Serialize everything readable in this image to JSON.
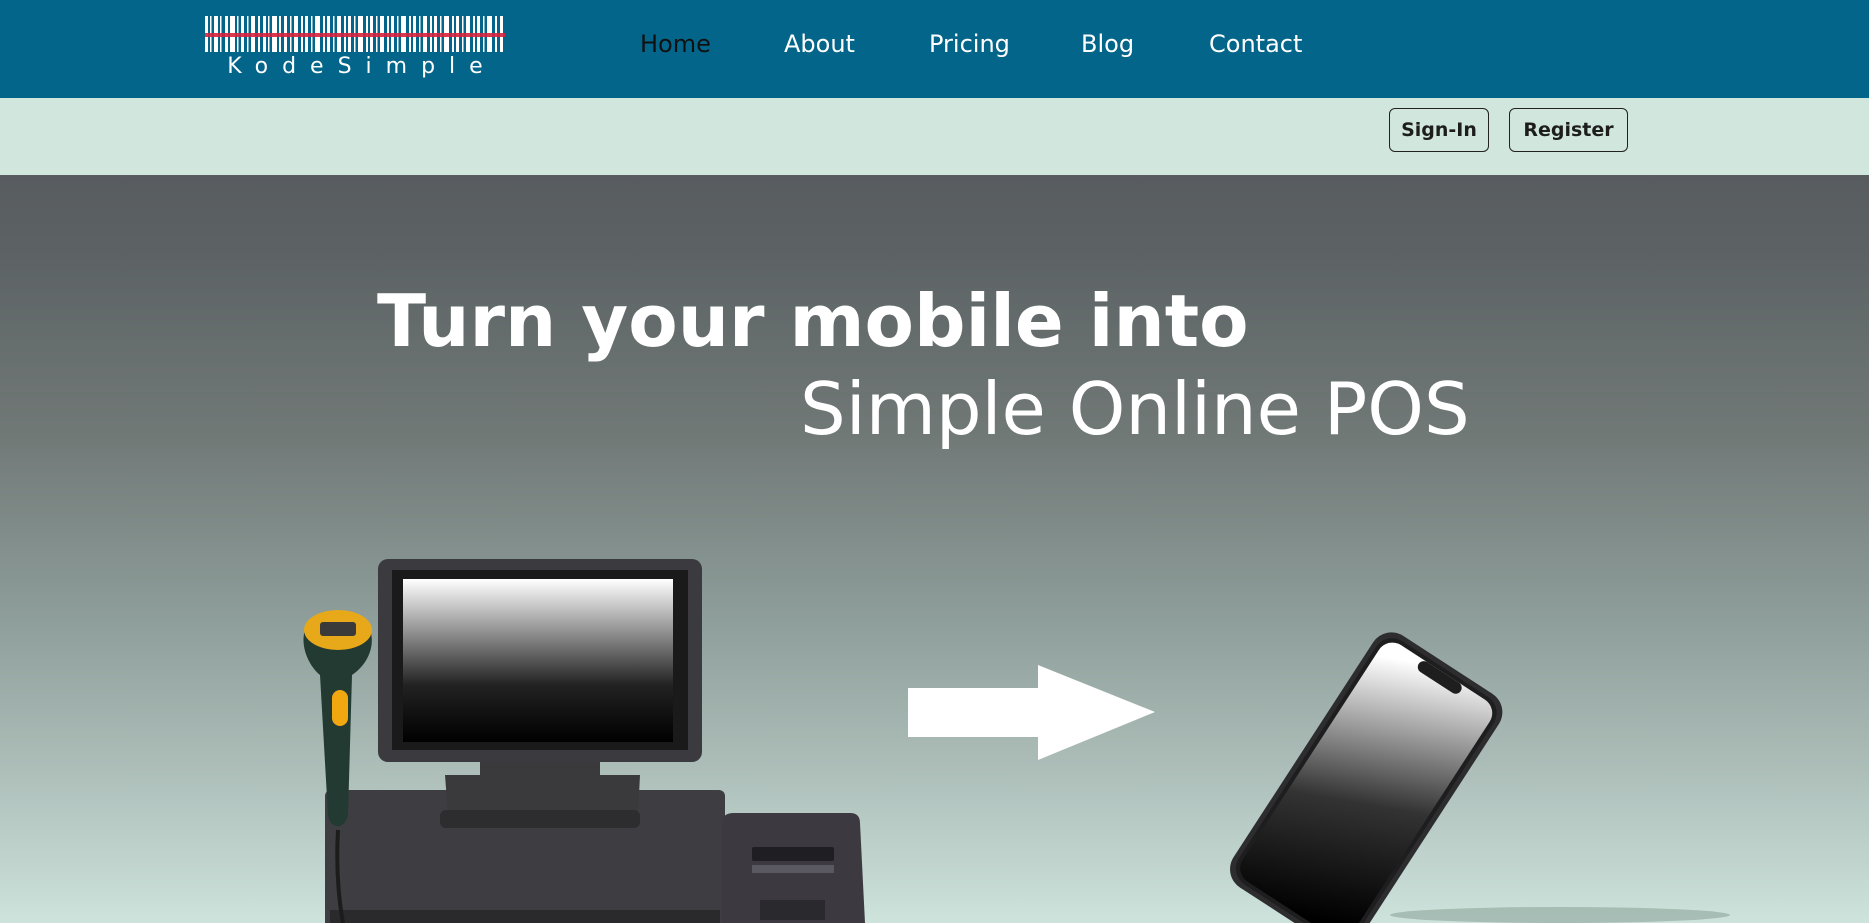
{
  "brand": {
    "name": "KodeSimple"
  },
  "nav": {
    "items": [
      {
        "label": "Home",
        "active": true
      },
      {
        "label": "About",
        "active": false
      },
      {
        "label": "Pricing",
        "active": false
      },
      {
        "label": "Blog",
        "active": false
      },
      {
        "label": "Contact",
        "active": false
      }
    ]
  },
  "auth": {
    "signin_label": "Sign-In",
    "register_label": "Register"
  },
  "hero": {
    "line1": "Turn your mobile into",
    "line2": "Simple Online POS"
  },
  "colors": {
    "nav_bg": "#03658a",
    "auth_bg": "#d1e6dd",
    "logo_accent": "#d6223c"
  },
  "icons": {
    "pos_terminal": "pos-terminal-icon",
    "barcode_scanner": "barcode-scanner-icon",
    "receipt_printer": "receipt-printer-icon",
    "arrow": "arrow-right-icon",
    "smartphone": "smartphone-icon"
  }
}
